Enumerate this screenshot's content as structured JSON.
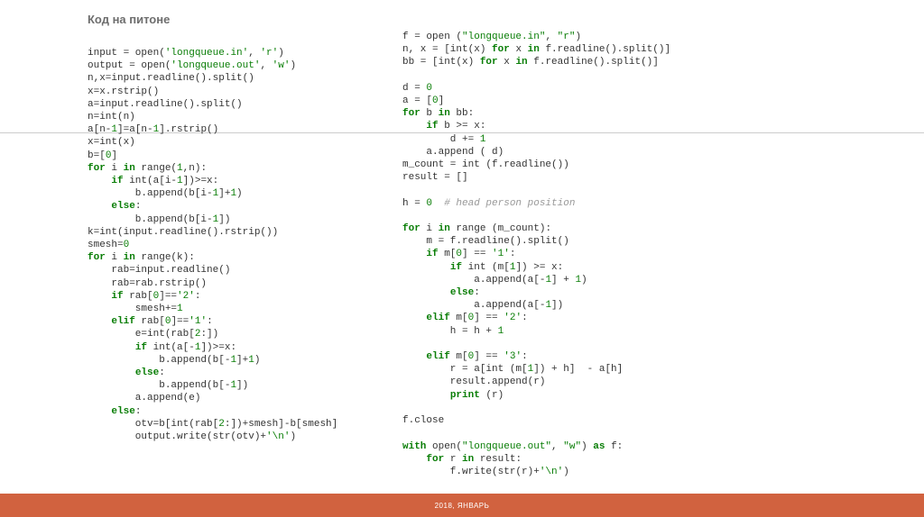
{
  "title": "Код на питоне",
  "footer": "2018, ЯНВАРЬ",
  "leftTokens": [
    {
      "t": "input = open(",
      "c": ""
    },
    {
      "t": "'longqueue.in'",
      "c": "str"
    },
    {
      "t": ", ",
      "c": ""
    },
    {
      "t": "'r'",
      "c": "str"
    },
    {
      "t": ")\n",
      "c": ""
    },
    {
      "t": "output = open(",
      "c": ""
    },
    {
      "t": "'longqueue.out'",
      "c": "str"
    },
    {
      "t": ", ",
      "c": ""
    },
    {
      "t": "'w'",
      "c": "str"
    },
    {
      "t": ")\n",
      "c": ""
    },
    {
      "t": "n,x=input.readline().split()\n",
      "c": ""
    },
    {
      "t": "x=x.rstrip()\n",
      "c": ""
    },
    {
      "t": "a=input.readline().split()\n",
      "c": ""
    },
    {
      "t": "n=int(n)\n",
      "c": ""
    },
    {
      "t": "a[n-",
      "c": ""
    },
    {
      "t": "1",
      "c": "num"
    },
    {
      "t": "]=a[n-",
      "c": ""
    },
    {
      "t": "1",
      "c": "num"
    },
    {
      "t": "].rstrip()\n",
      "c": ""
    },
    {
      "t": "x=int(x)\n",
      "c": ""
    },
    {
      "t": "b=[",
      "c": ""
    },
    {
      "t": "0",
      "c": "num"
    },
    {
      "t": "]\n",
      "c": ""
    },
    {
      "t": "for",
      "c": "kw"
    },
    {
      "t": " i ",
      "c": ""
    },
    {
      "t": "in",
      "c": "kw"
    },
    {
      "t": " range(",
      "c": ""
    },
    {
      "t": "1",
      "c": "num"
    },
    {
      "t": ",n):\n",
      "c": ""
    },
    {
      "t": "    ",
      "c": ""
    },
    {
      "t": "if",
      "c": "kw"
    },
    {
      "t": " int(a[i-",
      "c": ""
    },
    {
      "t": "1",
      "c": "num"
    },
    {
      "t": "])>=x:\n",
      "c": ""
    },
    {
      "t": "        b.append(b[i-",
      "c": ""
    },
    {
      "t": "1",
      "c": "num"
    },
    {
      "t": "]+",
      "c": ""
    },
    {
      "t": "1",
      "c": "num"
    },
    {
      "t": ")\n",
      "c": ""
    },
    {
      "t": "    ",
      "c": ""
    },
    {
      "t": "else",
      "c": "kw"
    },
    {
      "t": ":\n",
      "c": ""
    },
    {
      "t": "        b.append(b[i-",
      "c": ""
    },
    {
      "t": "1",
      "c": "num"
    },
    {
      "t": "])\n",
      "c": ""
    },
    {
      "t": "k=int(input.readline().rstrip())\n",
      "c": ""
    },
    {
      "t": "smesh=",
      "c": ""
    },
    {
      "t": "0",
      "c": "num"
    },
    {
      "t": "\n",
      "c": ""
    },
    {
      "t": "for",
      "c": "kw"
    },
    {
      "t": " i ",
      "c": ""
    },
    {
      "t": "in",
      "c": "kw"
    },
    {
      "t": " range(k):\n",
      "c": ""
    },
    {
      "t": "    rab=input.readline()\n",
      "c": ""
    },
    {
      "t": "    rab=rab.rstrip()\n",
      "c": ""
    },
    {
      "t": "    ",
      "c": ""
    },
    {
      "t": "if",
      "c": "kw"
    },
    {
      "t": " rab[",
      "c": ""
    },
    {
      "t": "0",
      "c": "num"
    },
    {
      "t": "]==",
      "c": ""
    },
    {
      "t": "'2'",
      "c": "str"
    },
    {
      "t": ":\n",
      "c": ""
    },
    {
      "t": "        smesh+=",
      "c": ""
    },
    {
      "t": "1",
      "c": "num"
    },
    {
      "t": "\n",
      "c": ""
    },
    {
      "t": "    ",
      "c": ""
    },
    {
      "t": "elif",
      "c": "kw"
    },
    {
      "t": " rab[",
      "c": ""
    },
    {
      "t": "0",
      "c": "num"
    },
    {
      "t": "]==",
      "c": ""
    },
    {
      "t": "'1'",
      "c": "str"
    },
    {
      "t": ":\n",
      "c": ""
    },
    {
      "t": "        e=int(rab[",
      "c": ""
    },
    {
      "t": "2",
      "c": "num"
    },
    {
      "t": ":])\n",
      "c": ""
    },
    {
      "t": "        ",
      "c": ""
    },
    {
      "t": "if",
      "c": "kw"
    },
    {
      "t": " int(a[-",
      "c": ""
    },
    {
      "t": "1",
      "c": "num"
    },
    {
      "t": "])>=x:\n",
      "c": ""
    },
    {
      "t": "            b.append(b[-",
      "c": ""
    },
    {
      "t": "1",
      "c": "num"
    },
    {
      "t": "]+",
      "c": ""
    },
    {
      "t": "1",
      "c": "num"
    },
    {
      "t": ")\n",
      "c": ""
    },
    {
      "t": "        ",
      "c": ""
    },
    {
      "t": "else",
      "c": "kw"
    },
    {
      "t": ":\n",
      "c": ""
    },
    {
      "t": "            b.append(b[-",
      "c": ""
    },
    {
      "t": "1",
      "c": "num"
    },
    {
      "t": "])\n",
      "c": ""
    },
    {
      "t": "        a.append(e)\n",
      "c": ""
    },
    {
      "t": "    ",
      "c": ""
    },
    {
      "t": "else",
      "c": "kw"
    },
    {
      "t": ":\n",
      "c": ""
    },
    {
      "t": "        otv=b[int(rab[",
      "c": ""
    },
    {
      "t": "2",
      "c": "num"
    },
    {
      "t": ":])+smesh]-b[smesh]\n",
      "c": ""
    },
    {
      "t": "        output.write(str(otv)+",
      "c": ""
    },
    {
      "t": "'\\n'",
      "c": "str"
    },
    {
      "t": ")",
      "c": ""
    }
  ],
  "rightTokens": [
    {
      "t": "f = open (",
      "c": ""
    },
    {
      "t": "\"longqueue.in\"",
      "c": "str"
    },
    {
      "t": ", ",
      "c": ""
    },
    {
      "t": "\"r\"",
      "c": "str"
    },
    {
      "t": ")\n",
      "c": ""
    },
    {
      "t": "n, x = [int(x) ",
      "c": ""
    },
    {
      "t": "for",
      "c": "kw"
    },
    {
      "t": " x ",
      "c": ""
    },
    {
      "t": "in",
      "c": "kw"
    },
    {
      "t": " f.readline().split()]\n",
      "c": ""
    },
    {
      "t": "bb = [int(x) ",
      "c": ""
    },
    {
      "t": "for",
      "c": "kw"
    },
    {
      "t": " x ",
      "c": ""
    },
    {
      "t": "in",
      "c": "kw"
    },
    {
      "t": " f.readline().split()]\n",
      "c": ""
    },
    {
      "t": "\n",
      "c": ""
    },
    {
      "t": "d = ",
      "c": ""
    },
    {
      "t": "0",
      "c": "num"
    },
    {
      "t": "\n",
      "c": ""
    },
    {
      "t": "a = [",
      "c": ""
    },
    {
      "t": "0",
      "c": "num"
    },
    {
      "t": "]\n",
      "c": ""
    },
    {
      "t": "for",
      "c": "kw"
    },
    {
      "t": " b ",
      "c": ""
    },
    {
      "t": "in",
      "c": "kw"
    },
    {
      "t": " bb:\n",
      "c": ""
    },
    {
      "t": "    ",
      "c": ""
    },
    {
      "t": "if",
      "c": "kw"
    },
    {
      "t": " b >= x:\n",
      "c": ""
    },
    {
      "t": "        d += ",
      "c": ""
    },
    {
      "t": "1",
      "c": "num"
    },
    {
      "t": "\n",
      "c": ""
    },
    {
      "t": "    a.append ( d)\n",
      "c": ""
    },
    {
      "t": "m_count = int (f.readline())\n",
      "c": ""
    },
    {
      "t": "result = []\n",
      "c": ""
    },
    {
      "t": "\n",
      "c": ""
    },
    {
      "t": "h = ",
      "c": ""
    },
    {
      "t": "0",
      "c": "num"
    },
    {
      "t": "  ",
      "c": ""
    },
    {
      "t": "# head person position",
      "c": "cmt"
    },
    {
      "t": "\n",
      "c": ""
    },
    {
      "t": "\n",
      "c": ""
    },
    {
      "t": "for",
      "c": "kw"
    },
    {
      "t": " i ",
      "c": ""
    },
    {
      "t": "in",
      "c": "kw"
    },
    {
      "t": " range (m_count):\n",
      "c": ""
    },
    {
      "t": "    m = f.readline().split()\n",
      "c": ""
    },
    {
      "t": "    ",
      "c": ""
    },
    {
      "t": "if",
      "c": "kw"
    },
    {
      "t": " m[",
      "c": ""
    },
    {
      "t": "0",
      "c": "num"
    },
    {
      "t": "] == ",
      "c": ""
    },
    {
      "t": "'1'",
      "c": "str"
    },
    {
      "t": ":\n",
      "c": ""
    },
    {
      "t": "        ",
      "c": ""
    },
    {
      "t": "if",
      "c": "kw"
    },
    {
      "t": " int (m[",
      "c": ""
    },
    {
      "t": "1",
      "c": "num"
    },
    {
      "t": "]) >= x:\n",
      "c": ""
    },
    {
      "t": "            a.append(a[-",
      "c": ""
    },
    {
      "t": "1",
      "c": "num"
    },
    {
      "t": "] + ",
      "c": ""
    },
    {
      "t": "1",
      "c": "num"
    },
    {
      "t": ")\n",
      "c": ""
    },
    {
      "t": "        ",
      "c": ""
    },
    {
      "t": "else",
      "c": "kw"
    },
    {
      "t": ":\n",
      "c": ""
    },
    {
      "t": "            a.append(a[-",
      "c": ""
    },
    {
      "t": "1",
      "c": "num"
    },
    {
      "t": "])\n",
      "c": ""
    },
    {
      "t": "    ",
      "c": ""
    },
    {
      "t": "elif",
      "c": "kw"
    },
    {
      "t": " m[",
      "c": ""
    },
    {
      "t": "0",
      "c": "num"
    },
    {
      "t": "] == ",
      "c": ""
    },
    {
      "t": "'2'",
      "c": "str"
    },
    {
      "t": ":\n",
      "c": ""
    },
    {
      "t": "        h = h + ",
      "c": ""
    },
    {
      "t": "1",
      "c": "num"
    },
    {
      "t": "\n",
      "c": ""
    },
    {
      "t": "\n",
      "c": ""
    },
    {
      "t": "    ",
      "c": ""
    },
    {
      "t": "elif",
      "c": "kw"
    },
    {
      "t": " m[",
      "c": ""
    },
    {
      "t": "0",
      "c": "num"
    },
    {
      "t": "] == ",
      "c": ""
    },
    {
      "t": "'3'",
      "c": "str"
    },
    {
      "t": ":\n",
      "c": ""
    },
    {
      "t": "        r = a[int (m[",
      "c": ""
    },
    {
      "t": "1",
      "c": "num"
    },
    {
      "t": "]) + h]  - a[h]\n",
      "c": ""
    },
    {
      "t": "        result.append(r)\n",
      "c": ""
    },
    {
      "t": "        ",
      "c": ""
    },
    {
      "t": "print",
      "c": "kw"
    },
    {
      "t": " (r)\n",
      "c": ""
    },
    {
      "t": "\n",
      "c": ""
    },
    {
      "t": "f.close\n",
      "c": ""
    },
    {
      "t": "\n",
      "c": ""
    },
    {
      "t": "with",
      "c": "kw"
    },
    {
      "t": " open(",
      "c": ""
    },
    {
      "t": "\"longqueue.out\"",
      "c": "str"
    },
    {
      "t": ", ",
      "c": ""
    },
    {
      "t": "\"w\"",
      "c": "str"
    },
    {
      "t": ") ",
      "c": ""
    },
    {
      "t": "as",
      "c": "kw"
    },
    {
      "t": " f:\n",
      "c": ""
    },
    {
      "t": "    ",
      "c": ""
    },
    {
      "t": "for",
      "c": "kw"
    },
    {
      "t": " r ",
      "c": ""
    },
    {
      "t": "in",
      "c": "kw"
    },
    {
      "t": " result:\n",
      "c": ""
    },
    {
      "t": "        f.write(str(r)+",
      "c": ""
    },
    {
      "t": "'\\n'",
      "c": "str"
    },
    {
      "t": ")",
      "c": ""
    }
  ]
}
